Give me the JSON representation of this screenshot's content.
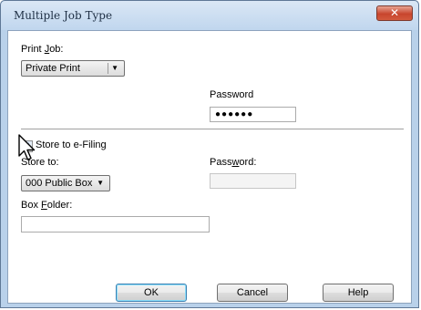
{
  "window": {
    "title": "Multiple Job Type",
    "close_label": "✕"
  },
  "print_job": {
    "label_pre": "Print ",
    "label_key": "J",
    "label_post": "ob:",
    "selected": "Private Print"
  },
  "password1": {
    "label": "Password",
    "value": "●●●●●●"
  },
  "efiling": {
    "checkbox_label": "Store to e-Filing",
    "checked": true,
    "store_to_label": "Store to:",
    "store_to_value": "000 Public Box",
    "password_label_pre": "Pass",
    "password_label_key": "w",
    "password_label_post": "ord:",
    "password_value": "",
    "box_folder_label_pre": "Box ",
    "box_folder_label_key": "F",
    "box_folder_label_post": "older:",
    "box_folder_value": ""
  },
  "buttons": {
    "ok": "OK",
    "cancel": "Cancel",
    "help": "Help"
  }
}
